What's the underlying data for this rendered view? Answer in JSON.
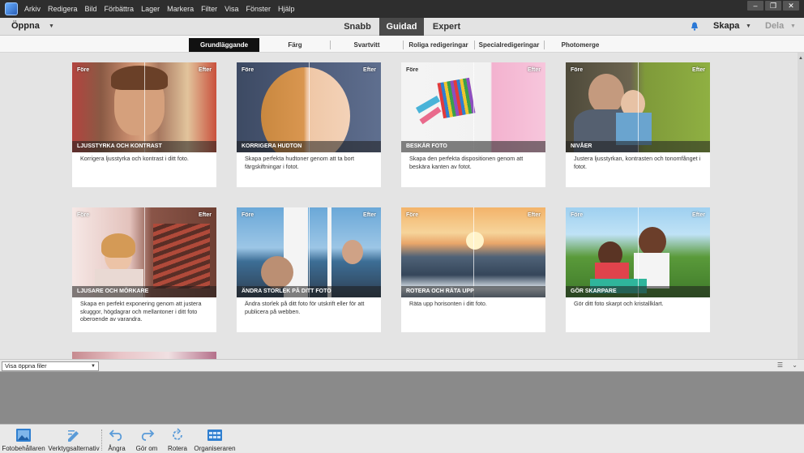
{
  "menubar": {
    "items": [
      "Arkiv",
      "Redigera",
      "Bild",
      "Förbättra",
      "Lager",
      "Markera",
      "Filter",
      "Visa",
      "Fönster",
      "Hjälp"
    ]
  },
  "window_controls": {
    "minimize": "–",
    "restore": "❐",
    "close": "✕"
  },
  "modebar": {
    "open_label": "Öppna",
    "tabs": [
      "Snabb",
      "Guidad",
      "Expert"
    ],
    "active_tab": "Guidad",
    "create_label": "Skapa",
    "share_label": "Dela"
  },
  "subtabs": {
    "items": [
      "Grundläggande",
      "Färg",
      "Svartvitt",
      "Roliga redigeringar",
      "Specialredigeringar",
      "Photomerge"
    ],
    "active": "Grundläggande"
  },
  "cards": [
    {
      "before": "Före",
      "after": "Efter",
      "title": "LJUSSTYRKA OCH KONTRAST",
      "desc": "Korrigera ljusstyrka och kontrast i ditt foto."
    },
    {
      "before": "Före",
      "after": "Efter",
      "title": "KORRIGERA HUDTON",
      "desc": "Skapa perfekta hudtoner genom att ta bort färgskiftningar i fotot."
    },
    {
      "before": "Före",
      "after": "Efter",
      "title": "BESKÄR FOTO",
      "desc": "Skapa den perfekta dispositionen genom att beskära kanten av fotot."
    },
    {
      "before": "Före",
      "after": "Efter",
      "title": "NIVÅER",
      "desc": "Justera ljusstyrkan, kontrasten och tonomfånget i fotot."
    },
    {
      "before": "Före",
      "after": "Efter",
      "title": "LJUSARE OCH MÖRKARE",
      "desc": "Skapa en perfekt exponering genom att justera skuggor, högdagrar och mellantoner i ditt foto oberoende av varandra."
    },
    {
      "before": "Före",
      "after": "Efter",
      "title": "ÄNDRA STORLEK PÅ DITT FOTO",
      "desc": "Ändra storlek på ditt foto för utskrift eller för att publicera på webben."
    },
    {
      "before": "Före",
      "after": "Efter",
      "title": "ROTERA OCH RÄTA UPP",
      "desc": "Räta upp horisonten i ditt foto."
    },
    {
      "before": "Före",
      "after": "Efter",
      "title": "GÖR SKARPARE",
      "desc": "Gör ditt foto skarpt och kristallklart."
    }
  ],
  "filebar": {
    "select_value": "Visa öppna filer"
  },
  "bottombar": {
    "items": [
      "Fotobehållaren",
      "Verktygsalternativ",
      "Ångra",
      "Gör om",
      "Rotera",
      "Organiseraren"
    ]
  }
}
